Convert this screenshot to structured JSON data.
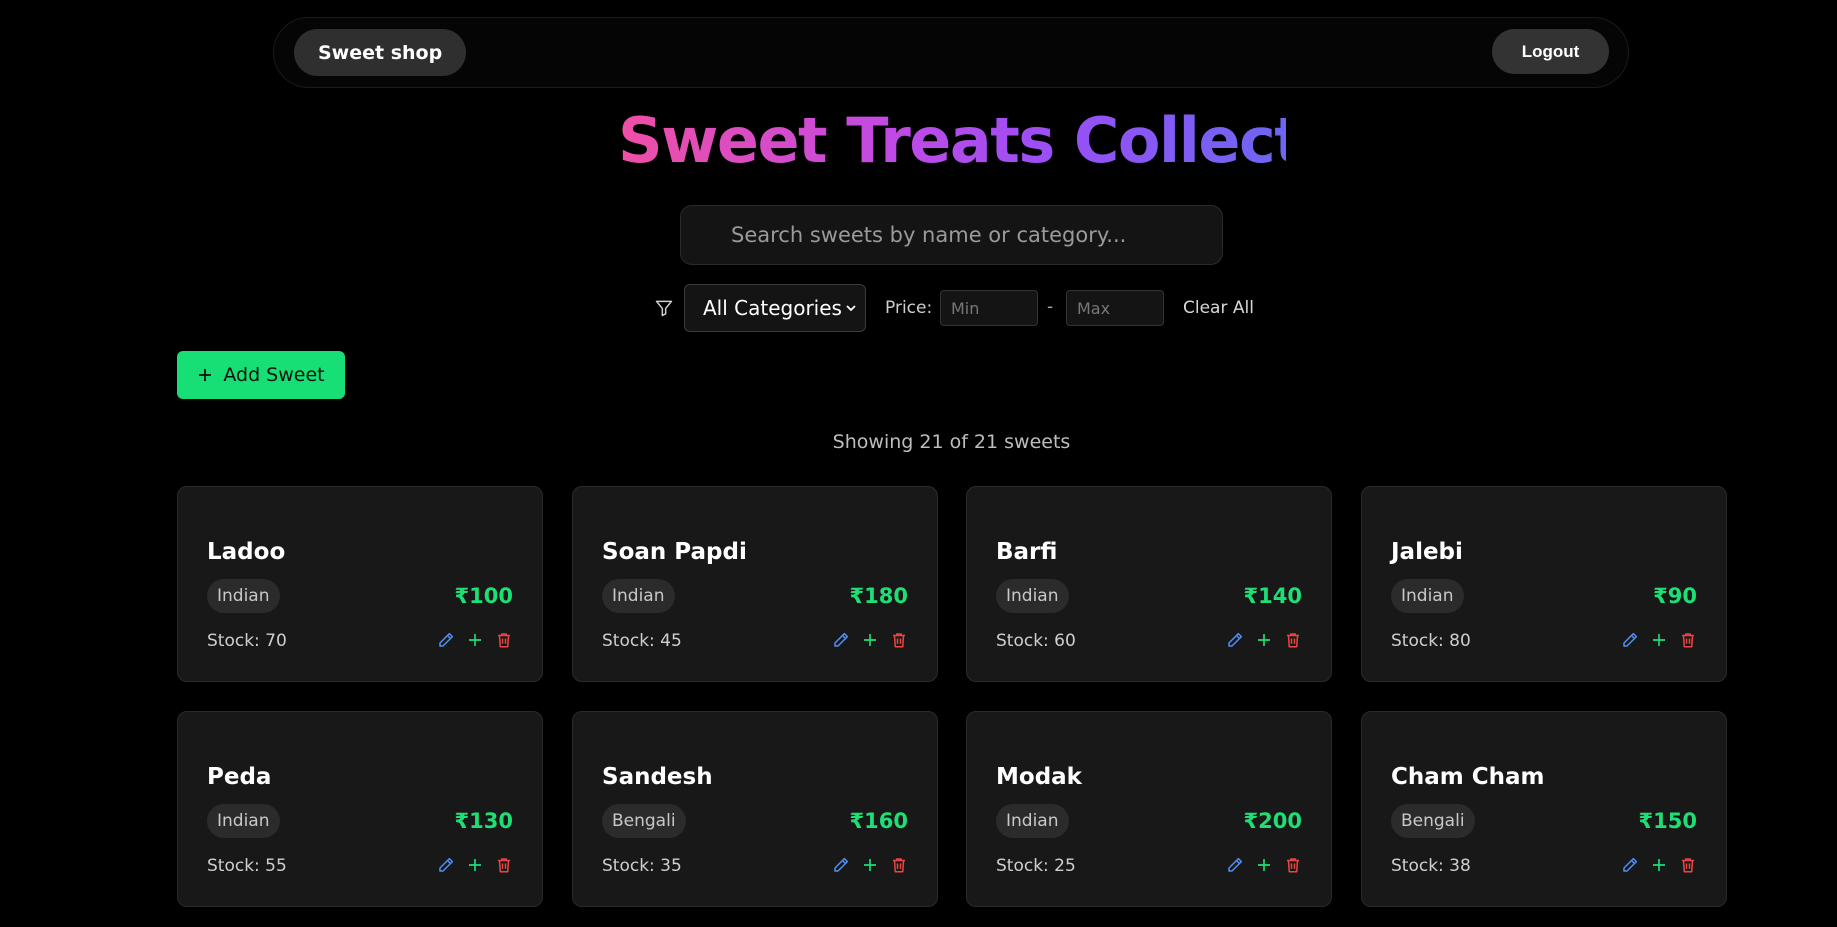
{
  "navbar": {
    "brand": "Sweet shop",
    "logout": "Logout"
  },
  "header": {
    "title": "Sweet Treats Collection"
  },
  "search": {
    "placeholder": "Search sweets by name or category..."
  },
  "filters": {
    "category_selected": "All Categories",
    "price_label": "Price:",
    "min_placeholder": "Min",
    "dash": "-",
    "max_placeholder": "Max",
    "clear_all": "Clear All"
  },
  "actions": {
    "add_sweet": "Add Sweet"
  },
  "results": {
    "summary": "Showing 21 of 21 sweets"
  },
  "sweets": [
    {
      "name": "Ladoo",
      "category": "Indian",
      "price": "₹100",
      "stock": "Stock: 70"
    },
    {
      "name": "Soan Papdi",
      "category": "Indian",
      "price": "₹180",
      "stock": "Stock: 45"
    },
    {
      "name": "Barfi",
      "category": "Indian",
      "price": "₹140",
      "stock": "Stock: 60"
    },
    {
      "name": "Jalebi",
      "category": "Indian",
      "price": "₹90",
      "stock": "Stock: 80"
    },
    {
      "name": "Peda",
      "category": "Indian",
      "price": "₹130",
      "stock": "Stock: 55"
    },
    {
      "name": "Sandesh",
      "category": "Bengali",
      "price": "₹160",
      "stock": "Stock: 35"
    },
    {
      "name": "Modak",
      "category": "Indian",
      "price": "₹200",
      "stock": "Stock: 25"
    },
    {
      "name": "Cham Cham",
      "category": "Bengali",
      "price": "₹150",
      "stock": "Stock: 38"
    }
  ],
  "colors": {
    "accent_green": "#17df76",
    "price_green": "#1ede76",
    "edit_blue": "#4f8ff7",
    "delete_red": "#ef4444"
  }
}
